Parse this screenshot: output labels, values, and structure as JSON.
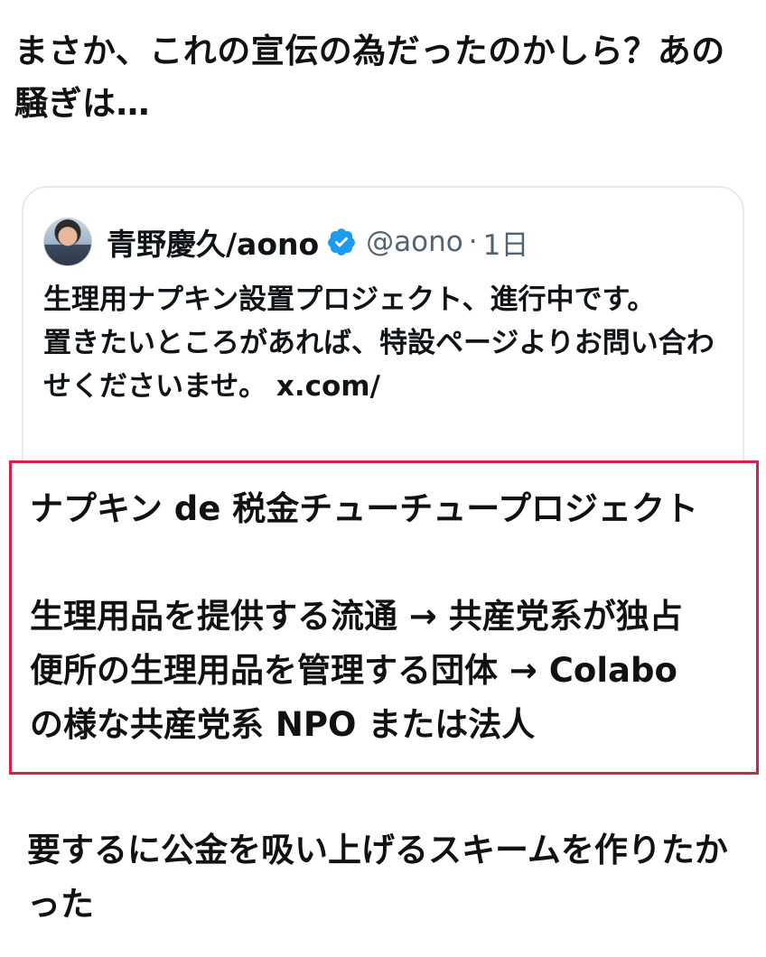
{
  "post": {
    "text": "まさか、これの宣伝の為だったのかしら？あの騒ぎは…"
  },
  "quoted_post": {
    "author_name": "青野慶久/aono",
    "handle": "@aono",
    "separator": "·",
    "age": "1日",
    "verified_icon": "verified-badge-icon",
    "body": "生理用ナプキン設置プロジェクト、進行中です。\n置きたいところがあれば、特設ページよりお問い合わせくださいませ。 x.com/"
  },
  "highlight": {
    "border_color": "#d81f46",
    "title": "ナプキン de 税金チューチュープロジェクト",
    "lines": [
      "生理用品を提供する流通 → 共産党系が独占",
      "便所の生理用品を管理する団体 → Colabo",
      "の様な共産党系 NPO または法人"
    ]
  },
  "conclusion": {
    "text": "要するに公金を吸い上げるスキームを作りたかった"
  },
  "colors": {
    "verified_blue": "#1d9bf0",
    "handle_gray": "#536471"
  }
}
